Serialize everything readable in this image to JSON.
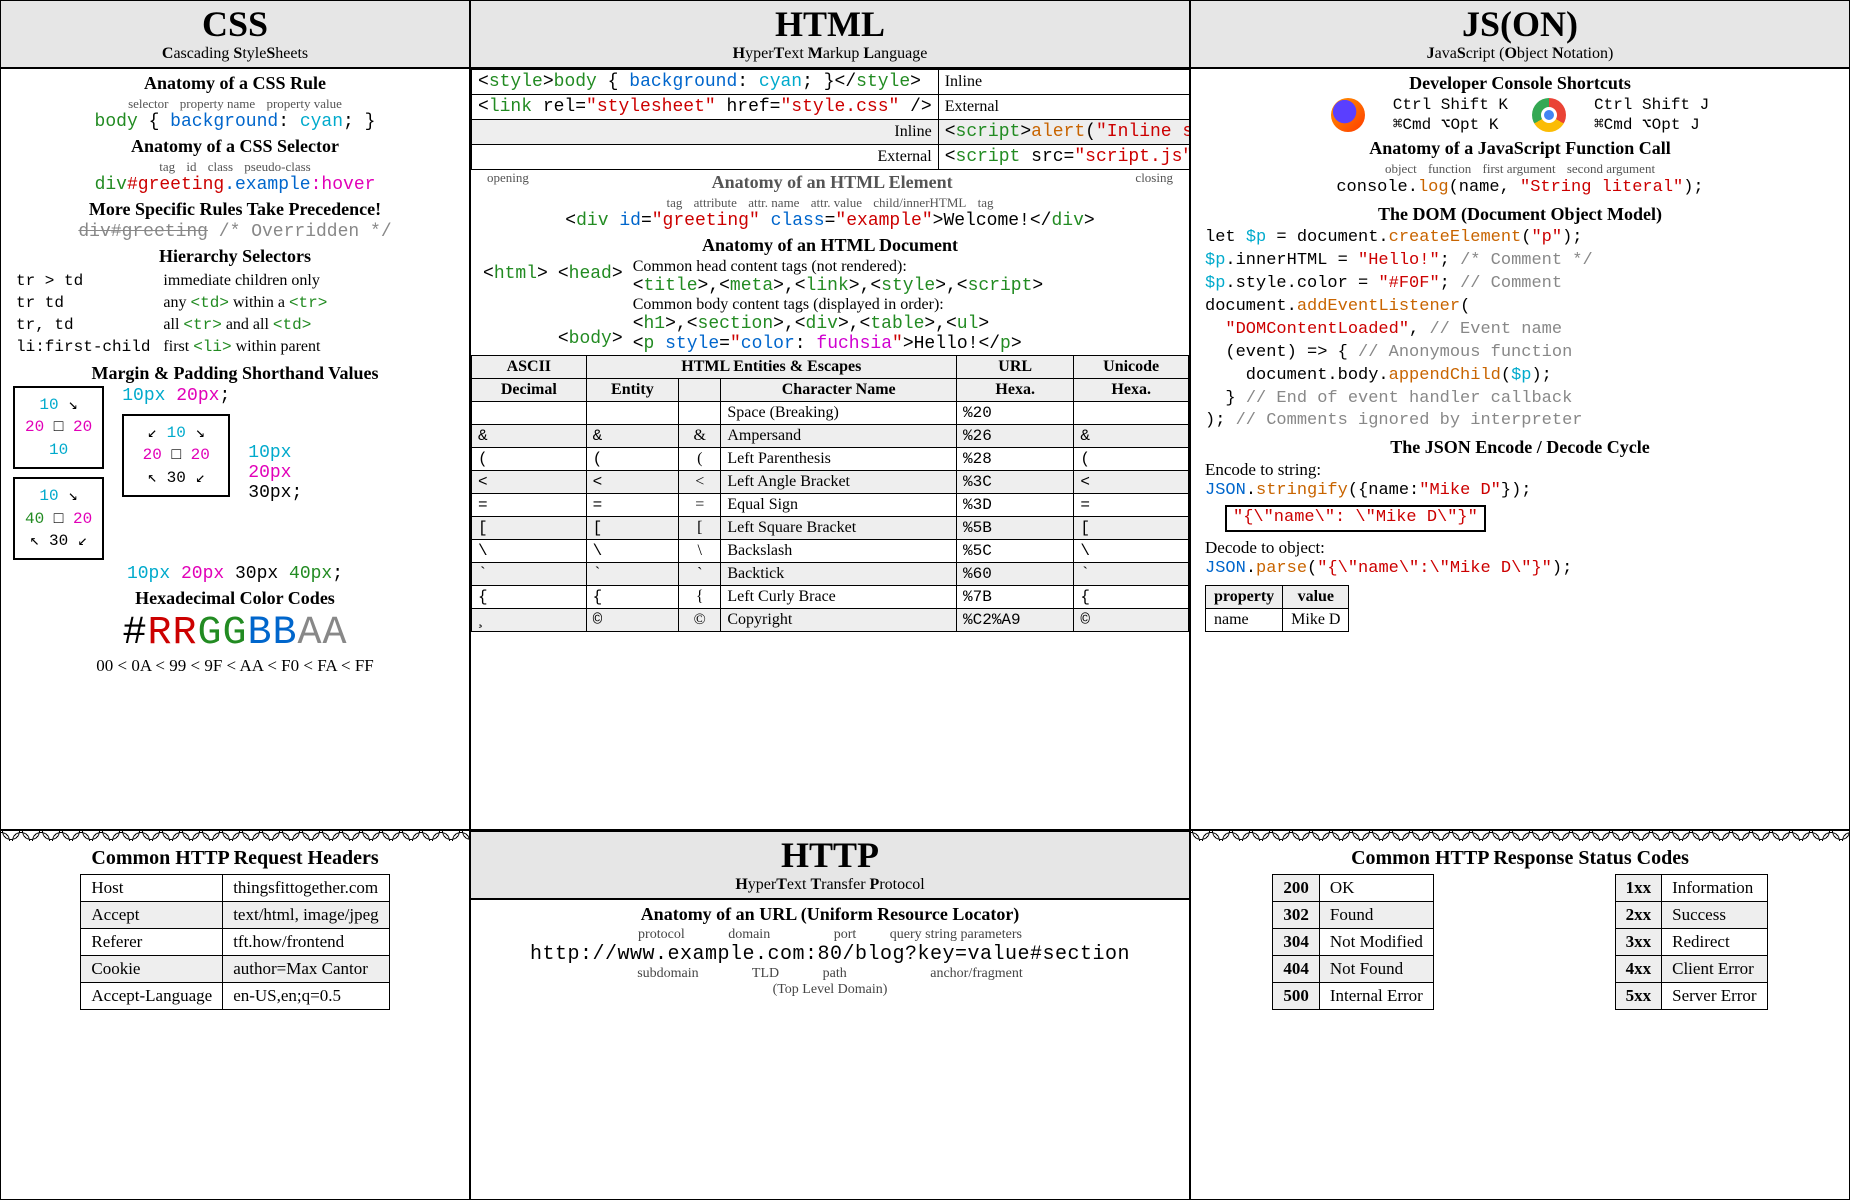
{
  "css": {
    "title": "CSS",
    "subtitle": "Cascading StyleSheets",
    "rule_heading": "Anatomy of a CSS Rule",
    "rule_labels": [
      "selector",
      "property name",
      "property value"
    ],
    "rule_code": "body { background: cyan; }",
    "selector_heading": "Anatomy of a CSS Selector",
    "selector_labels": [
      "tag",
      "id",
      "class",
      "pseudo-class"
    ],
    "selector_parts": [
      "div",
      "#greeting",
      ".example",
      ":hover"
    ],
    "precedence_heading": "More Specific Rules Take Precedence!",
    "overridden": "div#greeting /* Overridden */",
    "hierarchy_heading": "Hierarchy Selectors",
    "hierarchy": [
      {
        "sel": "tr > td",
        "desc": "immediate children only"
      },
      {
        "sel": "tr  td",
        "desc": "any <td> within a <tr>"
      },
      {
        "sel": "tr, td",
        "desc": "all <tr> and all <td>"
      },
      {
        "sel": "li:first-child",
        "desc": "first <li> within parent"
      }
    ],
    "mp_heading": "Margin & Padding Shorthand Values",
    "mp_two": "10px 20px;",
    "mp_three": [
      "10px",
      "20px",
      "30px;"
    ],
    "mp_four": "10px 20px 30px 40px;",
    "mp_box2": {
      "top": "10",
      "right": "20",
      "bottom": "10",
      "left": "20"
    },
    "mp_box3": {
      "top": "10",
      "right": "20",
      "bottom": "30",
      "left": "20"
    },
    "mp_box4": {
      "top": "10",
      "right": "20",
      "bottom": "30",
      "left": "40"
    },
    "hex_heading": "Hexadecimal Color Codes",
    "hex_code": "#RRGGBBAA",
    "hex_order": "00 < 0A < 99 < 9F < AA < F0 < FA < FF"
  },
  "html": {
    "title": "HTML",
    "subtitle": "HyperText Markup Language",
    "style_inline": "<style>body { background: cyan; }</style>",
    "style_inline_label": "Inline",
    "style_ext": "<link rel=\"stylesheet\" href=\"style.css\" />",
    "style_ext_label": "External",
    "script_inline_label": "Inline",
    "script_inline": "<script>alert(\"Inline script\");</scr ipt>",
    "script_ext_label": "External",
    "script_ext": "<script src=\"script.js\"></scr ipt>",
    "elem_heading": "Anatomy of an HTML Element",
    "elem_top_labels": [
      "opening",
      "closing"
    ],
    "elem_labels": [
      "tag",
      "attribute",
      "attr. name",
      "attr. value",
      "child/innerHTML",
      "tag"
    ],
    "elem_code": "<div id=\"greeting\" class=\"example\">Welcome!</div>",
    "doc_heading": "Anatomy of an HTML Document",
    "head_note": "Common head content tags (not rendered):",
    "head_tags": "<title>, <meta>, <link>, <style>, <script>",
    "body_note": "Common body content tags (displayed in order):",
    "body_tags": "<h1>, <section>, <div>, <table>, <ul>",
    "body_example": "<p style=\"color: fuchsia\">Hello!</p>",
    "ent_heading": "HTML Entities & Escapes",
    "ent_headers": [
      "ASCII",
      "URL",
      "Unicode"
    ],
    "ent_sub": [
      "Decimal",
      "Entity",
      "",
      "Character Name",
      "Hexa.",
      "Hexa."
    ],
    "entities": [
      {
        "dec": "&#32;",
        "ent": "&#32;",
        "ch": " ",
        "name": "Space (Breaking)",
        "url": "%20",
        "uni": "&#x20;"
      },
      {
        "dec": "&#38;",
        "ent": "&amp;",
        "ch": "&",
        "name": "Ampersand",
        "url": "%26",
        "uni": "&#x26;"
      },
      {
        "dec": "&#40;",
        "ent": "&lpar;",
        "ch": "(",
        "name": "Left Parenthesis",
        "url": "%28",
        "uni": "&#x28;"
      },
      {
        "dec": "&#60;",
        "ent": "&lt;",
        "ch": "<",
        "name": "Left Angle Bracket",
        "url": "%3C",
        "uni": "&#x3C;"
      },
      {
        "dec": "&#61;",
        "ent": "&equals;",
        "ch": "=",
        "name": "Equal Sign",
        "url": "%3D",
        "uni": "&#x3D;"
      },
      {
        "dec": "&#91;",
        "ent": "&lbrack;",
        "ch": "[",
        "name": "Left Square Bracket",
        "url": "%5B",
        "uni": "&#x5B;"
      },
      {
        "dec": "&#92;",
        "ent": "&bsol;",
        "ch": "\\",
        "name": "Backslash",
        "url": "%5C",
        "uni": "&#x5C;"
      },
      {
        "dec": "&#96;",
        "ent": "&grave;",
        "ch": "`",
        "name": "Backtick",
        "url": "%60",
        "uni": "&#x60;"
      },
      {
        "dec": "&#123;",
        "ent": "&lbrace;",
        "ch": "{",
        "name": "Left Curly Brace",
        "url": "%7B",
        "uni": "&#x7B;"
      },
      {
        "dec": "&#184;",
        "ent": "&copy;",
        "ch": "©",
        "name": "Copyright",
        "url": "%C2%A9",
        "uni": "&#xA9;"
      }
    ]
  },
  "js": {
    "title": "JS(ON)",
    "subtitle": "JavaScript (Object Notation)",
    "dev_heading": "Developer Console Shortcuts",
    "ff": [
      "Ctrl Shift K",
      "⌘Cmd ⌥Opt K"
    ],
    "ch": [
      "Ctrl Shift J",
      "⌘Cmd ⌥Opt J"
    ],
    "fn_heading": "Anatomy of a JavaScript Function Call",
    "fn_labels": [
      "object",
      "function",
      "first argument",
      "second argument"
    ],
    "fn_code": "console.log(name, \"String literal\");",
    "dom_heading": "The DOM (Document Object Model)",
    "dom_lines": [
      "let $p = document.createElement(\"p\");",
      "$p.innerHTML = \"Hello!\"; /* Comment */",
      "$p.style.color = \"#F0F\"; // Comment",
      "document.addEventListener(",
      "  \"DOMContentLoaded\", // Event name",
      "  (event) => { // Anonymous function",
      "    document.body.appendChild($p);",
      "  } // End of event handler callback",
      "); // Comments ignored by interpreter"
    ],
    "json_heading": "The JSON Encode / Decode Cycle",
    "encode_label": "Encode to string:",
    "encode_code": "JSON.stringify({name:\"Mike D\"});",
    "encode_result": "\"{\\\"name\\\": \\\"Mike D\\\"}\"",
    "decode_label": "Decode to object:",
    "decode_code": "JSON.parse(\"{\\\"name\\\":\\\"Mike D\\\"}\");",
    "table": {
      "headers": [
        "property",
        "value"
      ],
      "row": [
        "name",
        "Mike D"
      ]
    }
  },
  "http": {
    "title": "HTTP",
    "subtitle": "HyperText Transfer Protocol",
    "req_heading": "Common HTTP Request Headers",
    "req": [
      [
        "Host",
        "thingsfittogether.com"
      ],
      [
        "Accept",
        "text/html, image/jpeg"
      ],
      [
        "Referer",
        "tft.how/frontend"
      ],
      [
        "Cookie",
        "author=Max Cantor"
      ],
      [
        "Accept-Language",
        "en-US,en;q=0.5"
      ]
    ],
    "url_heading": "Anatomy of an URL (Uniform Resource Locator)",
    "url_top_labels": [
      "protocol",
      "domain",
      "port",
      "query string parameters"
    ],
    "url_code": "http://www.example.com:80/blog?key=value#section",
    "url_bottom_labels": [
      "subdomain",
      "TLD",
      "path",
      "anchor/fragment"
    ],
    "url_note": "(Top Level Domain)",
    "status_heading": "Common HTTP Response Status Codes",
    "status_specific": [
      [
        "200",
        "OK"
      ],
      [
        "302",
        "Found"
      ],
      [
        "304",
        "Not Modified"
      ],
      [
        "404",
        "Not Found"
      ],
      [
        "500",
        "Internal Error"
      ]
    ],
    "status_class": [
      [
        "1xx",
        "Information"
      ],
      [
        "2xx",
        "Success"
      ],
      [
        "3xx",
        "Redirect"
      ],
      [
        "4xx",
        "Client Error"
      ],
      [
        "5xx",
        "Server Error"
      ]
    ]
  }
}
